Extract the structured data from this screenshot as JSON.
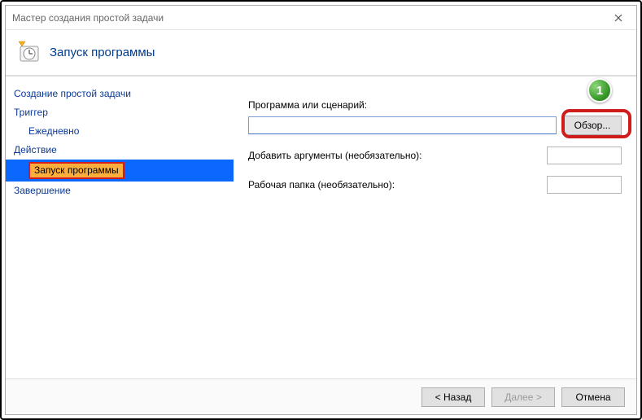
{
  "window": {
    "title": "Мастер создания простой задачи"
  },
  "header": {
    "title": "Запуск программы"
  },
  "sidebar": {
    "items": [
      {
        "label": "Создание простой задачи",
        "indent": false,
        "selected": false
      },
      {
        "label": "Триггер",
        "indent": false,
        "selected": false
      },
      {
        "label": "Ежедневно",
        "indent": true,
        "selected": false
      },
      {
        "label": "Действие",
        "indent": false,
        "selected": false
      },
      {
        "label": "Запуск программы",
        "indent": true,
        "selected": true
      },
      {
        "label": "Завершение",
        "indent": false,
        "selected": false
      }
    ]
  },
  "form": {
    "program_label": "Программа или сценарий:",
    "program_value": "",
    "browse_label": "Обзор...",
    "arguments_label": "Добавить аргументы (необязательно):",
    "arguments_value": "",
    "startin_label": "Рабочая папка (необязательно):",
    "startin_value": ""
  },
  "footer": {
    "back": "< Назад",
    "next": "Далее >",
    "cancel": "Отмена",
    "next_disabled": true
  },
  "annotation": {
    "badge": "1"
  }
}
